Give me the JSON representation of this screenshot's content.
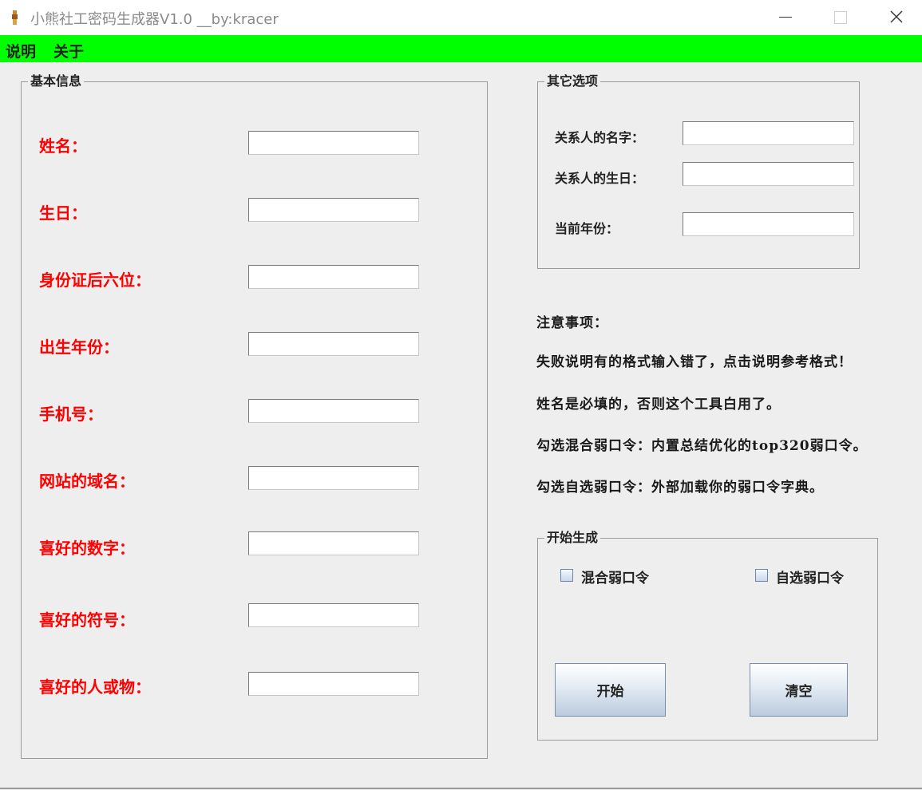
{
  "window": {
    "title": "小熊社工密码生成器V1.0  __by:kracer"
  },
  "menu": {
    "items": [
      "说明",
      "关于"
    ]
  },
  "basic_info": {
    "title": "基本信息",
    "fields": [
      {
        "label": "姓名：",
        "value": ""
      },
      {
        "label": "生日：",
        "value": ""
      },
      {
        "label": "身份证后六位：",
        "value": ""
      },
      {
        "label": "出生年份：",
        "value": ""
      },
      {
        "label": "手机号：",
        "value": ""
      },
      {
        "label": "网站的域名：",
        "value": ""
      },
      {
        "label": "喜好的数字：",
        "value": ""
      },
      {
        "label": "喜好的符号：",
        "value": ""
      },
      {
        "label": "喜好的人或物：",
        "value": ""
      }
    ]
  },
  "other_options": {
    "title": "其它选项",
    "fields": [
      {
        "label": "关系人的名字：",
        "value": ""
      },
      {
        "label": "关系人的生日：",
        "value": ""
      },
      {
        "label": "当前年份：",
        "value": ""
      }
    ]
  },
  "notes": [
    "注意事项：",
    "失败说明有的格式输入错了，点击说明参考格式！",
    "姓名是必填的，否则这个工具白用了。",
    "勾选混合弱口令：内置总结优化的top320弱口令。",
    "勾选自选弱口令：外部加载你的弱口令字典。"
  ],
  "generate": {
    "title": "开始生成",
    "mixed_checkbox": {
      "label": "混合弱口令",
      "checked": false
    },
    "custom_checkbox": {
      "label": "自选弱口令",
      "checked": false
    },
    "start_button": "开始",
    "clear_button": "清空"
  },
  "colors": {
    "menubar_bg": "#00ff00",
    "field_label": "#ff0000",
    "window_bg": "#eeeeee"
  }
}
